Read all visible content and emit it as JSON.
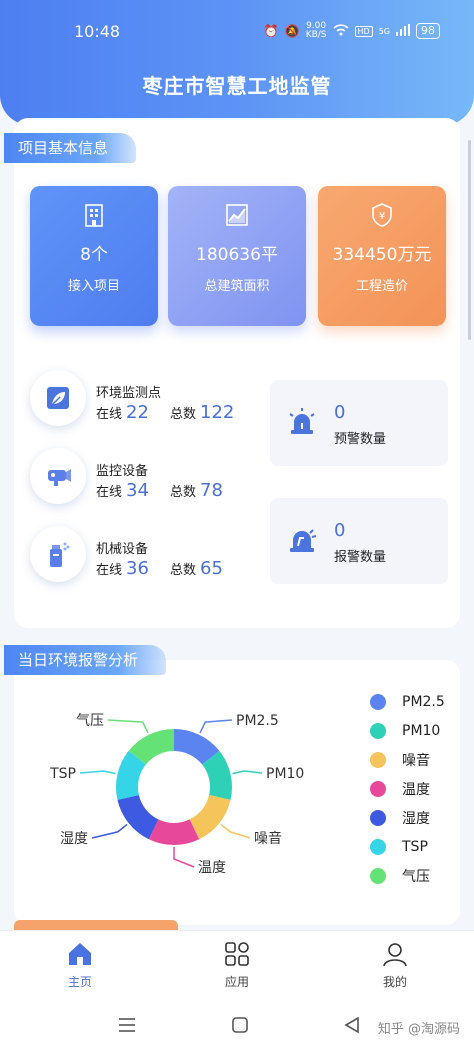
{
  "status": {
    "time": "10:48",
    "net_speed": "9.00",
    "net_unit": "KB/S",
    "hd": "HD",
    "signal": "5G",
    "battery": "98"
  },
  "app_title": "枣庄市智慧工地监管",
  "project_info": {
    "section_title": "项目基本信息",
    "cards": [
      {
        "value": "8个",
        "label": "接入项目",
        "icon": "building-icon",
        "color": "#5b8af5"
      },
      {
        "value": "180636平",
        "label": "总建筑面积",
        "icon": "area-chart-icon",
        "color": "#8ea3f5"
      },
      {
        "value": "334450万元",
        "label": "工程造价",
        "icon": "shield-yen-icon",
        "color": "#f6a067"
      }
    ]
  },
  "devices": [
    {
      "title": "环境监测点",
      "online_label": "在线",
      "online": "22",
      "total_label": "总数",
      "total": "122",
      "icon": "leaf-icon"
    },
    {
      "title": "监控设备",
      "online_label": "在线",
      "online": "34",
      "total_label": "总数",
      "total": "78",
      "icon": "camera-icon"
    },
    {
      "title": "机械设备",
      "online_label": "在线",
      "online": "36",
      "total_label": "总数",
      "total": "65",
      "icon": "machine-icon"
    }
  ],
  "alarms": [
    {
      "value": "0",
      "label": "预警数量",
      "icon": "siren-icon"
    },
    {
      "value": "0",
      "label": "报警数量",
      "icon": "alarm-light-icon"
    }
  ],
  "env_alarm": {
    "section_title": "当日环境报警分析",
    "chart_data": {
      "type": "pie",
      "categories": [
        "PM2.5",
        "PM10",
        "噪音",
        "温度",
        "湿度",
        "TSP",
        "气压"
      ],
      "values": [
        1,
        1,
        1,
        1,
        1,
        1,
        1
      ],
      "colors": [
        "#5b84f0",
        "#2fd1b6",
        "#f5c45a",
        "#e8489a",
        "#3d5ae0",
        "#35d4e6",
        "#65e276"
      ],
      "legend_position": "right"
    },
    "labels": [
      "PM2.5",
      "PM10",
      "噪音",
      "温度",
      "湿度",
      "TSP",
      "气压"
    ]
  },
  "tabbar": [
    {
      "label": "主页",
      "icon": "home-icon",
      "active": true
    },
    {
      "label": "应用",
      "icon": "apps-icon",
      "active": false
    },
    {
      "label": "我的",
      "icon": "user-icon",
      "active": false
    }
  ],
  "watermark": "知乎 @淘源码"
}
